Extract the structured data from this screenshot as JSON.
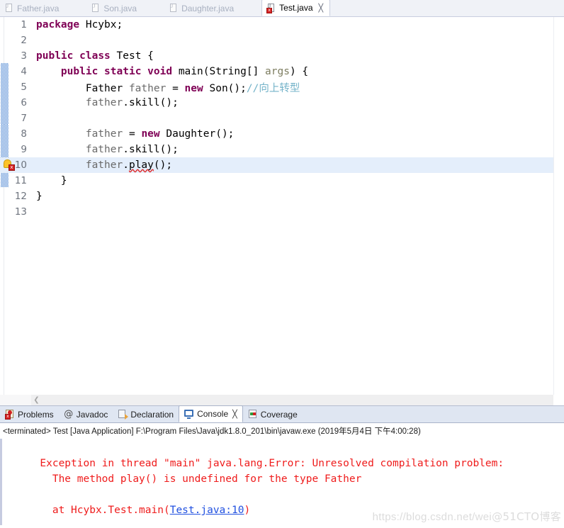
{
  "editor": {
    "tabs": [
      {
        "label": "Father.java",
        "icon": "java-file-icon",
        "active": false,
        "error": false
      },
      {
        "label": "Son.java",
        "icon": "java-file-icon",
        "active": false,
        "error": false
      },
      {
        "label": "Daughter.java",
        "icon": "java-file-icon",
        "active": false,
        "error": false
      },
      {
        "label": "Test.java",
        "icon": "java-file-error-icon",
        "active": true,
        "error": true
      }
    ],
    "close_glyph": "╳",
    "error_badge_glyph": "x",
    "scroll_left_glyph": "❮",
    "lines": [
      {
        "num": "1",
        "current": false,
        "marker": false,
        "fold": false
      },
      {
        "num": "2",
        "current": false,
        "marker": false,
        "fold": false
      },
      {
        "num": "3",
        "current": false,
        "marker": false,
        "fold": false
      },
      {
        "num": "4",
        "current": false,
        "marker": false,
        "fold": true
      },
      {
        "num": "5",
        "current": false,
        "marker": false,
        "fold": false
      },
      {
        "num": "6",
        "current": false,
        "marker": false,
        "fold": false
      },
      {
        "num": "7",
        "current": false,
        "marker": false,
        "fold": false
      },
      {
        "num": "8",
        "current": false,
        "marker": false,
        "fold": false
      },
      {
        "num": "9",
        "current": false,
        "marker": false,
        "fold": false
      },
      {
        "num": "10",
        "current": true,
        "marker": true,
        "fold": false
      },
      {
        "num": "11",
        "current": false,
        "marker": false,
        "fold": false
      },
      {
        "num": "12",
        "current": false,
        "marker": false,
        "fold": false
      },
      {
        "num": "13",
        "current": false,
        "marker": false,
        "fold": false
      }
    ],
    "code": {
      "l1_kw": "package",
      "l1_rest": " Hcybx;",
      "l3_kw1": "public",
      "l3_kw2": "class",
      "l3_rest": " Test {",
      "l4_kw1": "public",
      "l4_kw2": "static",
      "l4_kw3": "void",
      "l4_name": " main(String[] ",
      "l4_param": "args",
      "l4_tail": ") {",
      "l5_type": "Father ",
      "l5_var": "father",
      "l5_eq": " = ",
      "l5_kw": "new",
      "l5_ctor": " Son();",
      "l5_comment": "//向上转型",
      "l6_var": "father",
      "l6_call": ".skill();",
      "l8_var": "father",
      "l8_eq": " = ",
      "l8_kw": "new",
      "l8_ctor": " Daughter();",
      "l9_var": "father",
      "l9_call": ".skill();",
      "l10_var": "father",
      "l10_dot": ".",
      "l10_method": "play",
      "l10_tail": "();",
      "l11_brace": "}",
      "l12_brace": "}"
    }
  },
  "bottom_panel": {
    "tabs": [
      {
        "label": "Problems",
        "icon": "problems-icon",
        "active": false
      },
      {
        "label": "Javadoc",
        "icon": "javadoc-at-icon",
        "active": false
      },
      {
        "label": "Declaration",
        "icon": "declaration-icon",
        "active": false
      },
      {
        "label": "Console",
        "icon": "console-icon",
        "active": true
      },
      {
        "label": "Coverage",
        "icon": "coverage-icon",
        "active": false
      }
    ],
    "close_glyph": "╳",
    "javadoc_glyph": "@",
    "terminated_line": "<terminated> Test [Java Application] F:\\Program Files\\Java\\jdk1.8.0_201\\bin\\javaw.exe (2019年5月4日 下午4:00:28)",
    "console_output": {
      "line1": "Exception in thread \"main\" java.lang.Error: Unresolved compilation problem: ",
      "line2": "\tThe method play() is undefined for the type Father",
      "line3": "",
      "line4_prefix": "\tat Hcybx.Test.main(",
      "line4_link": "Test.java:10",
      "line4_suffix": ")"
    }
  },
  "watermark": {
    "text_left": "https://blog.csdn.net/wei",
    "text_right": "@51CTO博客"
  }
}
